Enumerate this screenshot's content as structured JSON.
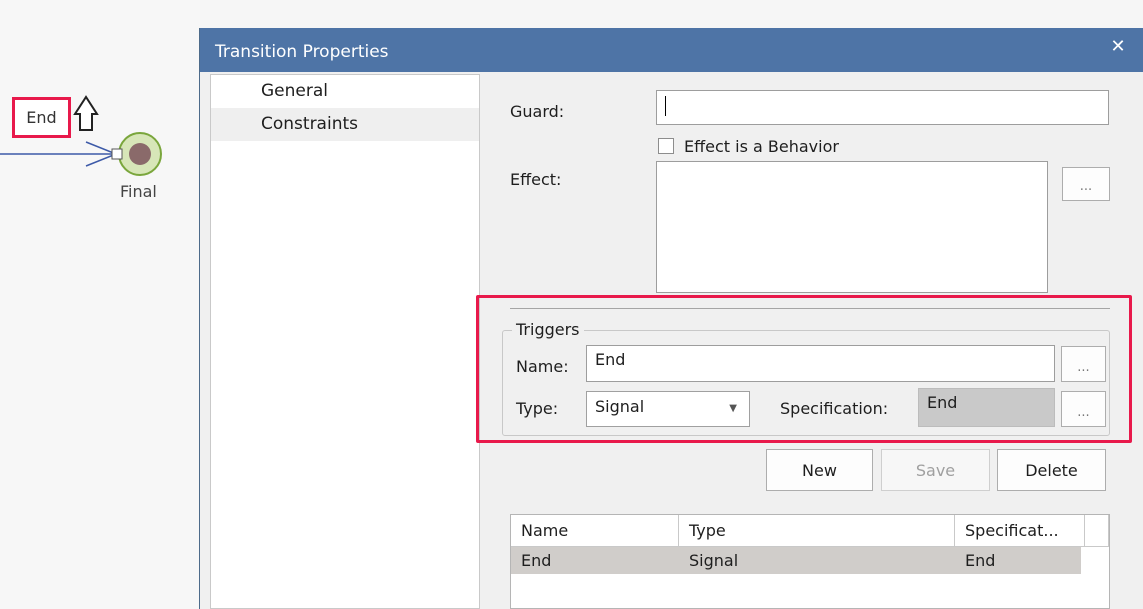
{
  "diagram": {
    "trigger_label": "End",
    "final_node_label": "Final"
  },
  "dialog": {
    "title": "Transition Properties",
    "close_glyph": "✕",
    "nav_items": [
      "General",
      "Constraints"
    ],
    "guard_label": "Guard:",
    "guard_value": "",
    "effect_is_behavior_label": "Effect is a Behavior",
    "effect_is_behavior_checked": false,
    "effect_label": "Effect:",
    "effect_value": "",
    "ellipsis": "...",
    "triggers": {
      "group_title": "Triggers",
      "name_label": "Name:",
      "name_value": "End",
      "type_label": "Type:",
      "type_value": "Signal",
      "specification_label": "Specification:",
      "specification_value": "End"
    },
    "buttons": {
      "new": "New",
      "save": "Save",
      "delete": "Delete"
    },
    "table": {
      "columns": [
        "Name",
        "Type",
        "Specificat..."
      ],
      "rows": [
        [
          "End",
          "Signal",
          "End"
        ]
      ]
    }
  }
}
